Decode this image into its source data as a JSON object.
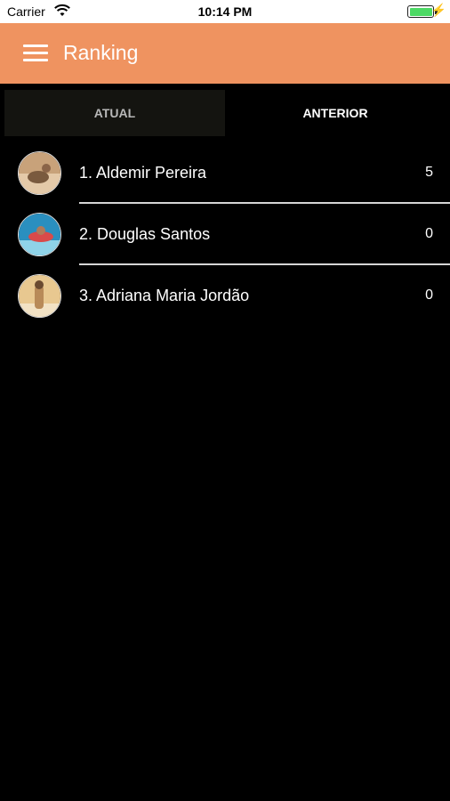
{
  "status_bar": {
    "carrier": "Carrier",
    "time": "10:14 PM",
    "battery_level": 1.0,
    "bolt": "⚡"
  },
  "header": {
    "title": "Ranking",
    "menu_icon": "hamburger-menu-icon",
    "color": "#ef9360"
  },
  "tabs": [
    {
      "label": "ATUAL",
      "selected": false
    },
    {
      "label": "ANTERIOR",
      "selected": true
    }
  ],
  "ranking": [
    {
      "position_name": "1. Aldemir Pereira",
      "score": "5",
      "avatar_colors": [
        "#c8a27a",
        "#e4c9a8",
        "#7a5a3e"
      ]
    },
    {
      "position_name": "2. Douglas Santos",
      "score": "0",
      "avatar_colors": [
        "#2a8fbf",
        "#8fd3e8",
        "#d94a4a"
      ]
    },
    {
      "position_name": "3. Adriana Maria Jordão",
      "score": "0",
      "avatar_colors": [
        "#e8c890",
        "#b88a58",
        "#f2e2c4"
      ]
    }
  ]
}
